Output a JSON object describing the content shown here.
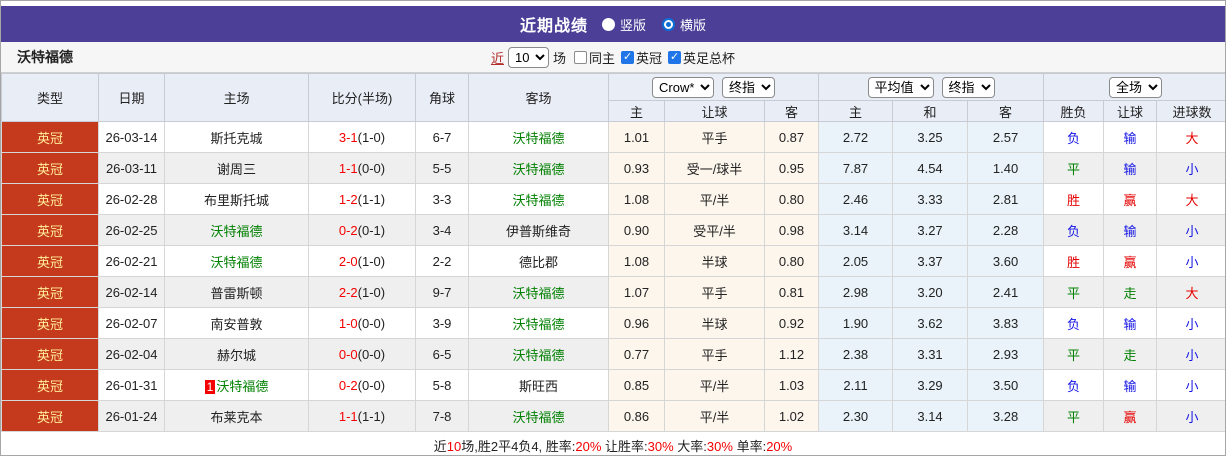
{
  "colors": {
    "titlebar_purple": "#4b3f98",
    "badge_bg": "#c5391d",
    "badge_text": "#ffee99",
    "team_green": "#008000",
    "score_red": "#f50000",
    "result_red": "#e60000",
    "result_green": "#008000",
    "result_blue": "#1414e6"
  },
  "title_bar": {
    "title": "近期战绩",
    "radios": [
      {
        "name": "vertical",
        "label": "竖版",
        "selected": false
      },
      {
        "name": "horizontal",
        "label": "横版",
        "selected": true
      }
    ]
  },
  "controls": {
    "team": "沃特福德",
    "recent_label": "近",
    "recent_count": "10",
    "matches_label": "场",
    "checkboxes": [
      {
        "name": "same-home",
        "label": "同主",
        "checked": false
      },
      {
        "name": "league",
        "label": "英冠",
        "checked": true
      },
      {
        "name": "cup",
        "label": "英足总杯",
        "checked": true
      }
    ]
  },
  "table": {
    "headers": {
      "type": "类型",
      "date": "日期",
      "home": "主场",
      "score": "比分(半场)",
      "corner": "角球",
      "away": "客场",
      "crow_select": "Crow*",
      "crow_final_select": "终指",
      "avg_select": "平均值",
      "avg_final_select": "终指",
      "fulltime_select": "全场",
      "sub": [
        "主",
        "让球",
        "客",
        "主",
        "和",
        "客",
        "胜负",
        "让球",
        "进球数"
      ]
    },
    "rows": [
      {
        "type": "英冠",
        "date": "26-03-14",
        "home": "斯托克城",
        "home_green": false,
        "home_mark": null,
        "score_ft": "3-1",
        "score_ht": "(1-0)",
        "corner": "6-7",
        "away": "沃特福德",
        "away_green": true,
        "odds": [
          "1.01",
          "平手",
          "0.87"
        ],
        "avg": [
          "2.72",
          "3.25",
          "2.57"
        ],
        "results": [
          {
            "text": "负",
            "color": "blue"
          },
          {
            "text": "输",
            "color": "blue"
          },
          {
            "text": "大",
            "color": "red"
          }
        ]
      },
      {
        "type": "英冠",
        "date": "26-03-11",
        "home": "谢周三",
        "home_green": false,
        "home_mark": null,
        "score_ft": "1-1",
        "score_ht": "(0-0)",
        "corner": "5-5",
        "away": "沃特福德",
        "away_green": true,
        "odds": [
          "0.93",
          "受一/球半",
          "0.95"
        ],
        "avg": [
          "7.87",
          "4.54",
          "1.40"
        ],
        "results": [
          {
            "text": "平",
            "color": "green"
          },
          {
            "text": "输",
            "color": "blue"
          },
          {
            "text": "小",
            "color": "blue"
          }
        ]
      },
      {
        "type": "英冠",
        "date": "26-02-28",
        "home": "布里斯托城",
        "home_green": false,
        "home_mark": null,
        "score_ft": "1-2",
        "score_ht": "(1-1)",
        "corner": "3-3",
        "away": "沃特福德",
        "away_green": true,
        "odds": [
          "1.08",
          "平/半",
          "0.80"
        ],
        "avg": [
          "2.46",
          "3.33",
          "2.81"
        ],
        "results": [
          {
            "text": "胜",
            "color": "red"
          },
          {
            "text": "赢",
            "color": "red"
          },
          {
            "text": "大",
            "color": "red"
          }
        ]
      },
      {
        "type": "英冠",
        "date": "26-02-25",
        "home": "沃特福德",
        "home_green": true,
        "home_mark": null,
        "score_ft": "0-2",
        "score_ht": "(0-1)",
        "corner": "3-4",
        "away": "伊普斯维奇",
        "away_green": false,
        "odds": [
          "0.90",
          "受平/半",
          "0.98"
        ],
        "avg": [
          "3.14",
          "3.27",
          "2.28"
        ],
        "results": [
          {
            "text": "负",
            "color": "blue"
          },
          {
            "text": "输",
            "color": "blue"
          },
          {
            "text": "小",
            "color": "blue"
          }
        ]
      },
      {
        "type": "英冠",
        "date": "26-02-21",
        "home": "沃特福德",
        "home_green": true,
        "home_mark": null,
        "score_ft": "2-0",
        "score_ht": "(1-0)",
        "corner": "2-2",
        "away": "德比郡",
        "away_green": false,
        "odds": [
          "1.08",
          "半球",
          "0.80"
        ],
        "avg": [
          "2.05",
          "3.37",
          "3.60"
        ],
        "results": [
          {
            "text": "胜",
            "color": "red"
          },
          {
            "text": "赢",
            "color": "red"
          },
          {
            "text": "小",
            "color": "blue"
          }
        ]
      },
      {
        "type": "英冠",
        "date": "26-02-14",
        "home": "普雷斯顿",
        "home_green": false,
        "home_mark": null,
        "score_ft": "2-2",
        "score_ht": "(1-0)",
        "corner": "9-7",
        "away": "沃特福德",
        "away_green": true,
        "odds": [
          "1.07",
          "平手",
          "0.81"
        ],
        "avg": [
          "2.98",
          "3.20",
          "2.41"
        ],
        "results": [
          {
            "text": "平",
            "color": "green"
          },
          {
            "text": "走",
            "color": "green"
          },
          {
            "text": "大",
            "color": "red"
          }
        ]
      },
      {
        "type": "英冠",
        "date": "26-02-07",
        "home": "南安普敦",
        "home_green": false,
        "home_mark": null,
        "score_ft": "1-0",
        "score_ht": "(0-0)",
        "corner": "3-9",
        "away": "沃特福德",
        "away_green": true,
        "odds": [
          "0.96",
          "半球",
          "0.92"
        ],
        "avg": [
          "1.90",
          "3.62",
          "3.83"
        ],
        "results": [
          {
            "text": "负",
            "color": "blue"
          },
          {
            "text": "输",
            "color": "blue"
          },
          {
            "text": "小",
            "color": "blue"
          }
        ]
      },
      {
        "type": "英冠",
        "date": "26-02-04",
        "home": "赫尔城",
        "home_green": false,
        "home_mark": null,
        "score_ft": "0-0",
        "score_ht": "(0-0)",
        "corner": "6-5",
        "away": "沃特福德",
        "away_green": true,
        "odds": [
          "0.77",
          "平手",
          "1.12"
        ],
        "avg": [
          "2.38",
          "3.31",
          "2.93"
        ],
        "results": [
          {
            "text": "平",
            "color": "green"
          },
          {
            "text": "走",
            "color": "green"
          },
          {
            "text": "小",
            "color": "blue"
          }
        ]
      },
      {
        "type": "英冠",
        "date": "26-01-31",
        "home": "沃特福德",
        "home_green": true,
        "home_mark": "1",
        "score_ft": "0-2",
        "score_ht": "(0-0)",
        "corner": "5-8",
        "away": "斯旺西",
        "away_green": false,
        "odds": [
          "0.85",
          "平/半",
          "1.03"
        ],
        "avg": [
          "2.11",
          "3.29",
          "3.50"
        ],
        "results": [
          {
            "text": "负",
            "color": "blue"
          },
          {
            "text": "输",
            "color": "blue"
          },
          {
            "text": "小",
            "color": "blue"
          }
        ]
      },
      {
        "type": "英冠",
        "date": "26-01-24",
        "home": "布莱克本",
        "home_green": false,
        "home_mark": null,
        "score_ft": "1-1",
        "score_ht": "(1-1)",
        "corner": "7-8",
        "away": "沃特福德",
        "away_green": true,
        "odds": [
          "0.86",
          "平/半",
          "1.02"
        ],
        "avg": [
          "2.30",
          "3.14",
          "3.28"
        ],
        "results": [
          {
            "text": "平",
            "color": "green"
          },
          {
            "text": "赢",
            "color": "red"
          },
          {
            "text": "小",
            "color": "blue"
          }
        ]
      }
    ]
  },
  "footer": {
    "parts": [
      {
        "text": "近",
        "red": false
      },
      {
        "text": "10",
        "red": true
      },
      {
        "text": "场,胜2平4负4, 胜率:",
        "red": false
      },
      {
        "text": "20%",
        "red": true
      },
      {
        "text": " 让胜率:",
        "red": false
      },
      {
        "text": "30%",
        "red": true
      },
      {
        "text": " 大率:",
        "red": false
      },
      {
        "text": "30%",
        "red": true
      },
      {
        "text": " 单率:",
        "red": false
      },
      {
        "text": "20%",
        "red": true
      }
    ]
  }
}
